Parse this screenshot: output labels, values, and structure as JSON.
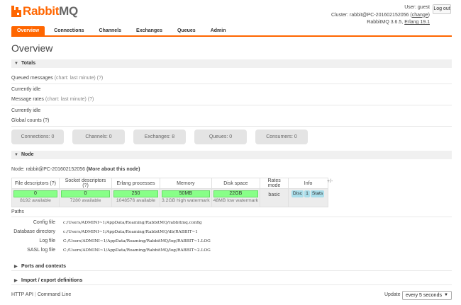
{
  "header": {
    "logo_main": "Rabbit",
    "logo_mq": "MQ",
    "user": "User: guest",
    "cluster_prefix": "Cluster: rabbit@PC-201602152056 (",
    "cluster_change": "change",
    "cluster_suffix": ")",
    "version_prefix": "RabbitMQ 3.6.5, ",
    "erlang": "Erlang 19.1",
    "logout": "Log out"
  },
  "nav": [
    "Overview",
    "Connections",
    "Channels",
    "Exchanges",
    "Queues",
    "Admin"
  ],
  "page_title": "Overview",
  "totals": {
    "heading": "Totals",
    "queued_label": "Queued messages",
    "chart_hint": "(chart: last minute) (?)",
    "idle1": "Currently idle",
    "rates_label": "Message rates",
    "idle2": "Currently idle",
    "global_counts": "Global counts (?)",
    "counts": [
      {
        "label": "Connections: 0"
      },
      {
        "label": "Channels: 0"
      },
      {
        "label": "Exchanges: 8"
      },
      {
        "label": "Queues: 0"
      },
      {
        "label": "Consumers: 0"
      }
    ]
  },
  "node": {
    "heading": "Node",
    "node_prefix": "Node: rabbit@PC-201602152056",
    "more_about": "(More about this node)",
    "columns": [
      "File descriptors (?)",
      "Socket descriptors (?)",
      "Erlang processes",
      "Memory",
      "Disk space",
      "Rates mode",
      "Info"
    ],
    "file_desc": {
      "value": "0",
      "sub": "8192 available"
    },
    "socket_desc": {
      "value": "0",
      "sub": "7280 available"
    },
    "erlang_proc": {
      "value": "250",
      "sub": "1048576 available"
    },
    "memory": {
      "value": "50MB",
      "sub": "3.2GB high watermark"
    },
    "disk": {
      "value": "22GB",
      "sub": "48MB low watermark"
    },
    "rates_mode": "basic",
    "info_tags": [
      "Disc",
      "1",
      "Stats"
    ],
    "plus_minus": "+/-"
  },
  "paths": {
    "heading": "Paths",
    "rows": [
      {
        "label": "Config file",
        "value": "c:/Users/ADMINI~1/AppData/Roaming/RabbitMQ/rabbitmq.config"
      },
      {
        "label": "Database directory",
        "value": "c:/Users/ADMINI~1/AppData/Roaming/RabbitMQ/db/RABBIT~1"
      },
      {
        "label": "Log file",
        "value": "C:/Users/ADMINI~1/AppData/Roaming/RabbitMQ/log/RABBIT~1.LOG"
      },
      {
        "label": "SASL log file",
        "value": "C:/Users/ADMINI~1/AppData/Roaming/RabbitMQ/log/RABBIT~2.LOG"
      }
    ]
  },
  "collapsed": [
    "Ports and contexts",
    "Import / export definitions"
  ],
  "footer": {
    "http_api": "HTTP API",
    "command_line": "Command Line",
    "update_label": "Update",
    "update_value": "every 5 seconds"
  },
  "colors": {
    "accent": "#ff6600",
    "bar_fill": "#88ff88",
    "tag": "#aadeea"
  }
}
